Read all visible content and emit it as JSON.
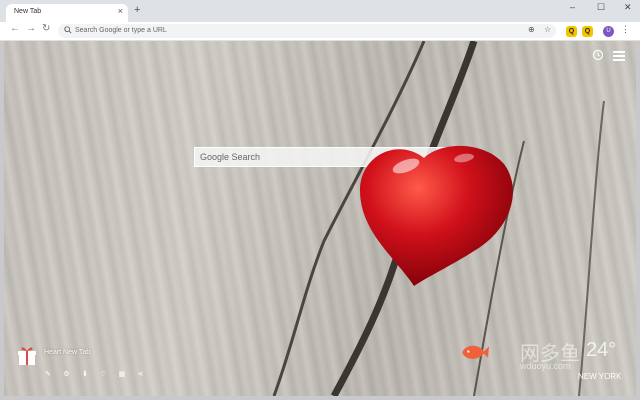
{
  "browser": {
    "tab_title": "New Tab",
    "tab_close": "×",
    "new_tab": "+",
    "window_buttons": [
      "–",
      "☐",
      "✕"
    ],
    "omnibox_placeholder": "Search Google or type a URL",
    "extensions": [
      "Q",
      "Q"
    ],
    "profile_initial": "U"
  },
  "page": {
    "search_placeholder": "Google Search",
    "new_tab_label": "Heart New Tab",
    "watermark_text": "网多鱼",
    "watermark_domain": "wduoyu.com",
    "temperature": "24°",
    "city": "NEW YORK",
    "tool_icons": [
      "pencil-icon",
      "settings-icon",
      "download-icon",
      "heart-icon",
      "grid-icon",
      "share-icon"
    ]
  },
  "colors": {
    "heart": "#d0101a",
    "extension_badge": "#f5c400",
    "profile": "#7e57c2"
  }
}
